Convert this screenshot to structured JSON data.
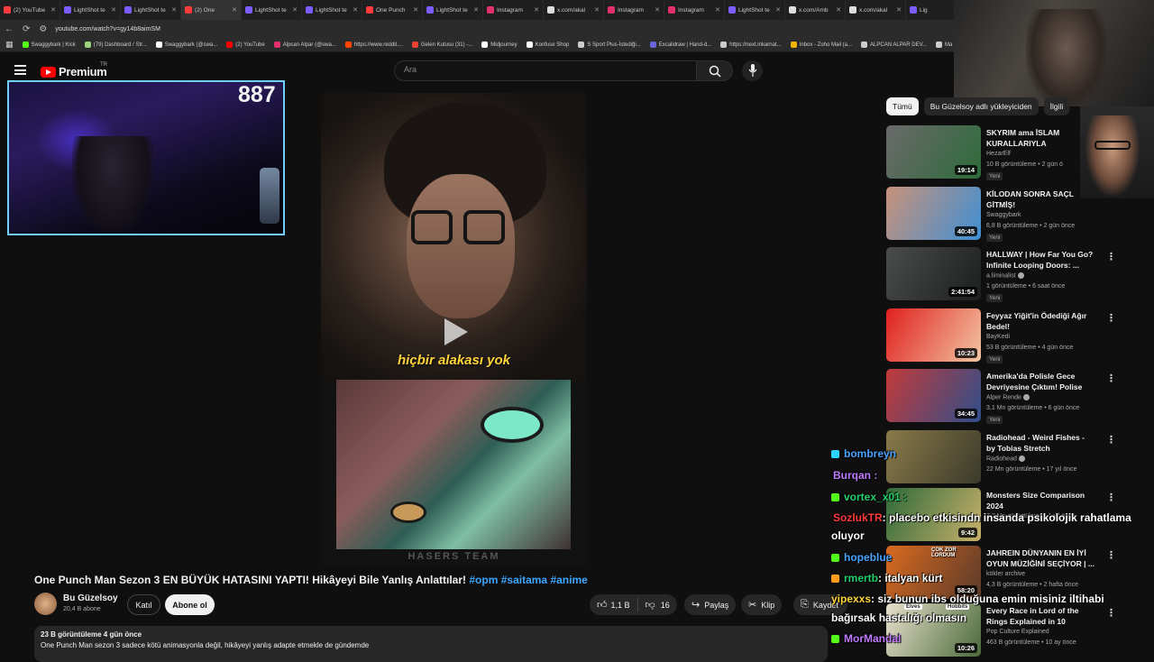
{
  "browser": {
    "tabs": [
      {
        "label": "(2) YouTube",
        "color": "#ff3b3b"
      },
      {
        "label": "LightShot te",
        "color": "#7a5cff"
      },
      {
        "label": "LightShot te",
        "color": "#7a5cff"
      },
      {
        "label": "(2) One",
        "color": "#ff3b3b"
      },
      {
        "label": "LightShot te",
        "color": "#7a5cff"
      },
      {
        "label": "LightShot te",
        "color": "#7a5cff"
      },
      {
        "label": "One Punch",
        "color": "#ff3b3b"
      },
      {
        "label": "LightShot te",
        "color": "#7a5cff"
      },
      {
        "label": "Instagram",
        "color": "#e1306c"
      },
      {
        "label": "x.com/akal",
        "color": "#dddddd"
      },
      {
        "label": "Instagram",
        "color": "#e1306c"
      },
      {
        "label": "Instagram",
        "color": "#e1306c"
      },
      {
        "label": "LightShot te",
        "color": "#7a5cff"
      },
      {
        "label": "x.com/Amb",
        "color": "#dddddd"
      },
      {
        "label": "x.com/akal",
        "color": "#dddddd"
      },
      {
        "label": "Lig",
        "color": "#7a5cff"
      }
    ],
    "url": "youtube.com/watch?v=gy14b8aimSM",
    "bookmarks": [
      {
        "label": "Swaggybark | Kick",
        "color": "#53fc18"
      },
      {
        "label": "(79) Dashboard / Str...",
        "color": "#9ad17a"
      },
      {
        "label": "Swaggybark (@swa...",
        "color": "#ffffff"
      },
      {
        "label": "(2) YouTube",
        "color": "#ff0000"
      },
      {
        "label": "Alpcan Alpar (@swa...",
        "color": "#e1306c"
      },
      {
        "label": "https://www.reddit....",
        "color": "#ff4500"
      },
      {
        "label": "Gelen Kutusu (31) -...",
        "color": "#ea4335"
      },
      {
        "label": "Midjourney",
        "color": "#ffffff"
      },
      {
        "label": "Konfuse Shop",
        "color": "#ffffff"
      },
      {
        "label": "S Sport Plus-İstediği...",
        "color": "#cccccc"
      },
      {
        "label": "Excalidraw | Hand-d...",
        "color": "#6965db"
      },
      {
        "label": "https://next.inkarnat...",
        "color": "#cccccc"
      },
      {
        "label": "Inbox - Zoho Mail (a...",
        "color": "#f0b400"
      },
      {
        "label": "ALPCAN ALPAR DEV...",
        "color": "#cccccc"
      },
      {
        "label": "Ma",
        "color": "#cccccc"
      }
    ]
  },
  "header": {
    "logo_text": "Premium",
    "region": "TR",
    "search_placeholder": "Ara"
  },
  "stream": {
    "viewer_count": "887"
  },
  "player": {
    "subtitle": "hiçbir alakası yok",
    "watermark": "HASERS TEAM"
  },
  "video": {
    "title_main": "One Punch Man Sezon 3 EN BÜYÜK HATASINI YAPTI! Hikâyeyi Bile Yanlış Anlattılar!",
    "hashtags": [
      "#opm",
      "#saitama",
      "#anime"
    ],
    "channel": "Bu Güzelsoy",
    "subscribers": "20,4 B abone",
    "join_label": "Katıl",
    "subscribe_label": "Abone ol",
    "likes": "1,1 B",
    "dislikes": "16",
    "share_label": "Paylaş",
    "clip_label": "Klip",
    "save_label": "Kaydet",
    "views_date": "23 B görüntüleme  4 gün önce",
    "description": "One Punch Man sezon 3 sadece kötü animasyonla değil, hikâyeyi yanlış adapte etmekle de gündemde"
  },
  "sidebar": {
    "chips": [
      "Tümü",
      "Bu Güzelsoy adlı yükleyiciden",
      "İlgili"
    ],
    "recommendations": [
      {
        "title": "SKYRIM ama İSLAM KURALLARIYLA",
        "channel": "HezarElf",
        "meta": "10 B görüntüleme • 2 gün ö",
        "badge": "Yeni",
        "duration": "19:14",
        "verified": false,
        "colors": [
          "#6a6a6a",
          "#2e6b3a"
        ]
      },
      {
        "title": "KİLODAN SONRA SAÇL GİTMİŞ!",
        "channel": "Swaggybark",
        "meta": "6,8 B görüntüleme • 2 gün önce",
        "badge": "Yeni",
        "duration": "40:45",
        "verified": false,
        "colors": [
          "#c8927a",
          "#3f8fd4"
        ]
      },
      {
        "title": "HALLWAY | How Far You Go? Infinite Looping Doors: ...",
        "channel": "a.liminalist",
        "meta": "1 görüntüleme • 6 saat önce",
        "badge": "Yeni",
        "duration": "2:41:54",
        "verified": true,
        "colors": [
          "#4a4d4c",
          "#1b1e1d"
        ]
      },
      {
        "title": "Feyyaz Yiğit'in Ödediği Ağır Bedel!",
        "channel": "BayKedi",
        "meta": "53 B görüntüleme • 4 gün önce",
        "badge": "Yeni",
        "duration": "10:23",
        "verified": false,
        "colors": [
          "#e0201f",
          "#f2c5a2"
        ]
      },
      {
        "title": "Amerika'da Polisle Gece Devriyesine Çıktım! Polise Küf...",
        "channel": "Alper Rende",
        "meta": "3,1 Mn görüntüleme • 6 gün önce",
        "badge": "Yeni",
        "duration": "34:45",
        "verified": true,
        "colors": [
          "#c23a3a",
          "#2f4f8a"
        ]
      },
      {
        "title": "Radiohead - Weird Fishes -  by Tobias Stretch",
        "channel": "Radiohead",
        "meta": "22 Mn görüntüleme • 17 yıl önce",
        "badge": "",
        "duration": "",
        "verified": true,
        "colors": [
          "#8a7a4a",
          "#3a3a2a"
        ]
      },
      {
        "title": "Monsters Size Comparison 2024",
        "channel": "",
        "meta": "7,7 Mn görüntüleme • 1 yıl önce",
        "badge": "",
        "duration": "9:42",
        "verified": false,
        "colors": [
          "#2e6a3a",
          "#c8b06a"
        ]
      },
      {
        "title": "JAHREIN DÜNYANIN EN İYİ OYUN MÜZİĞİNİ SEÇİYOR | ...",
        "channel": "kökler archive",
        "meta": "4,3 B görüntüleme • 2 hafta önce",
        "badge": "",
        "duration": "58:20",
        "verified": false,
        "colors": [
          "#d96a1f",
          "#5a3a2a"
        ],
        "thumb_text": "ÇOK ZOR LORDUM"
      },
      {
        "title": "Every Race in Lord of the Rings Explained in 10 Minutes",
        "channel": "Pop Culture Explained",
        "meta": "463 B görüntüleme • 10 ay önce",
        "badge": "",
        "duration": "10:26",
        "verified": false,
        "colors": [
          "#e8e0cc",
          "#4a6a3a"
        ],
        "thumb_labels": [
          "Elves",
          "Hobbits"
        ]
      }
    ]
  },
  "chat": [
    {
      "user": "bombreyn",
      "user_color": "#4aa3ff",
      "message": "",
      "badge_color": "#2ad4ff"
    },
    {
      "user": "Burqan :",
      "user_color": "#c07aff",
      "message": "",
      "badge_color": ""
    },
    {
      "user": "vortex_x01 :",
      "user_color": "#22d16a",
      "message": "",
      "badge_color": "#53fc18"
    },
    {
      "user": "SozlukTR",
      "user_color": "#ff3b3b",
      "message": ": placebo etkisindn insanda psikolojik rahatlama",
      "badge_color": ""
    },
    {
      "user": "",
      "user_color": "#ffffff",
      "message": "oluyor",
      "badge_color": ""
    },
    {
      "user": "hopeblue",
      "user_color": "#4aa3ff",
      "message": "",
      "badge_color": "#53fc18"
    },
    {
      "user": "rmertb",
      "user_color": "#22d16a",
      "message": ": italyan kürt",
      "badge_color": "#ff9c1a"
    },
    {
      "user": "yipexxs",
      "user_color": "#ffd33a",
      "message": ": siz bunun ibs olduğuna emin misiniz iltihabi",
      "badge_color": ""
    },
    {
      "user": "",
      "user_color": "#ffffff",
      "message": "bağırsak hastalığı olmasın",
      "badge_color": ""
    },
    {
      "user": "MorMandal",
      "user_color": "#c07aff",
      "message": "",
      "badge_color": "#53fc18"
    }
  ]
}
